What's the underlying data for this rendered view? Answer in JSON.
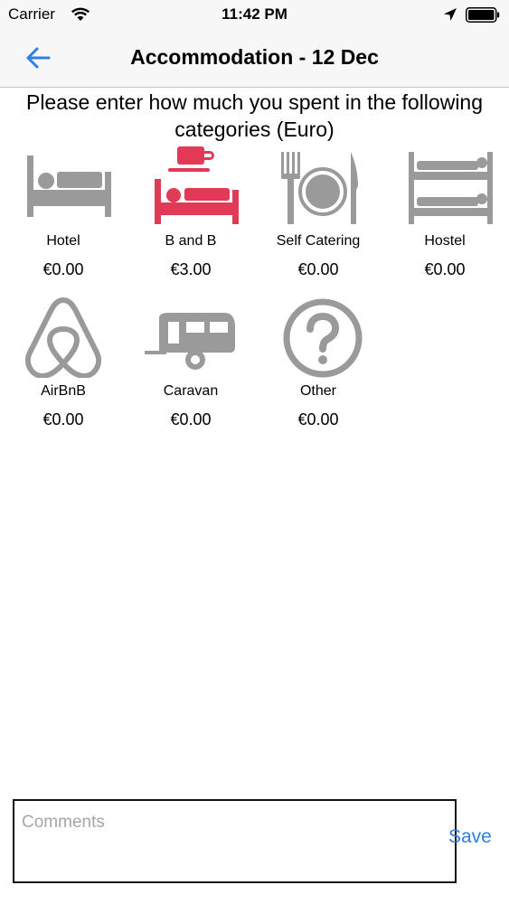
{
  "status_bar": {
    "carrier": "Carrier",
    "time": "11:42 PM"
  },
  "nav": {
    "title": "Accommodation - 12 Dec"
  },
  "instructions": "Please enter how much you spent in the following categories (Euro)",
  "colors": {
    "icon_default": "#9a9a9a",
    "icon_selected": "#e03a57",
    "link": "#2f7fe0"
  },
  "categories": [
    {
      "label": "Hotel",
      "amount": "€0.00",
      "icon": "bed-icon",
      "selected": false
    },
    {
      "label": "B and B",
      "amount": "€3.00",
      "icon": "bed-and-breakfast-icon",
      "selected": true
    },
    {
      "label": "Self Catering",
      "amount": "€0.00",
      "icon": "fork-plate-knife-icon",
      "selected": false
    },
    {
      "label": "Hostel",
      "amount": "€0.00",
      "icon": "bunk-bed-icon",
      "selected": false
    },
    {
      "label": "AirBnB",
      "amount": "€0.00",
      "icon": "airbnb-logo-icon",
      "selected": false
    },
    {
      "label": "Caravan",
      "amount": "€0.00",
      "icon": "caravan-icon",
      "selected": false
    },
    {
      "label": "Other",
      "amount": "€0.00",
      "icon": "question-mark-icon",
      "selected": false
    }
  ],
  "comments": {
    "placeholder": "Comments",
    "value": ""
  },
  "save_label": "Save"
}
